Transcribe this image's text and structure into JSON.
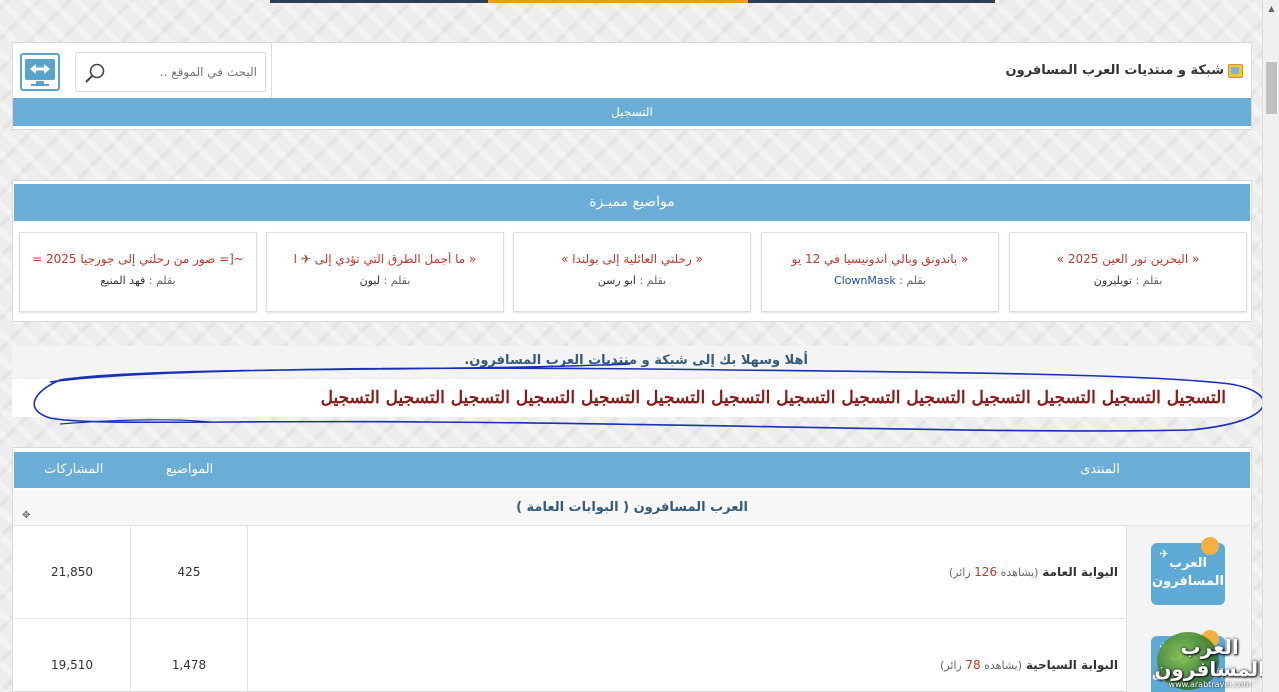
{
  "header": {
    "site_title": "شبكة و منتديات العرب المسافرون",
    "search_placeholder": "البحث في الموقع ..",
    "register_label": "التسجيل"
  },
  "featured": {
    "title": "مواضيع مميـزة",
    "by_label": "بقلم :",
    "cards": [
      {
        "title": "« البحرين نور العين 2025 »",
        "author": "تويليرون",
        "author_color": "#333333"
      },
      {
        "title": "« باندونق وبالي اندونيسيا في 12 يو",
        "author": "ClownMask",
        "author_color": "#1f4fa3"
      },
      {
        "title": "« رحلتي العائلية إلى بولندا »",
        "author": "ابو رسن",
        "author_color": "#333333"
      },
      {
        "title": "« ما أجمل الطرق التي تؤدي إلى ✈ ا",
        "author": "ليون",
        "author_color": "#333333"
      },
      {
        "title": "~[= صور من رحلتي إلى جورجيا 2025 =",
        "author": "فهد المنيع",
        "author_color": "#333333"
      }
    ]
  },
  "welcome": {
    "text": "أهلا وسهلا بك إلى شبكة و منتديات العرب المسافرون.",
    "register_repeat": "التسجيل التسجيل التسجيل التسجيل التسجيل التسجيل التسجيل التسجيل التسجيل التسجيل التسجيل التسجيل التسجيل التسجيل"
  },
  "forum_table": {
    "headers": {
      "forum": "المنتدى",
      "topics": "المواضيع",
      "posts": "المشاركات"
    },
    "section_title": "العرب المسافرون ( البوابات العامة )",
    "logo_text": [
      "العرب",
      "المسافرون"
    ],
    "rows": [
      {
        "name": "البوابة العامة",
        "viewing_prefix": "(يشاهده",
        "viewing_count": "126",
        "viewing_suffix": "زائر)",
        "topics": "425",
        "posts": "21,850"
      },
      {
        "name": "البوابة السياحية",
        "viewing_prefix": "(يشاهده",
        "viewing_count": "78",
        "viewing_suffix": "زائر)",
        "topics": "1,478",
        "posts": "19,510"
      }
    ]
  },
  "watermark": {
    "text_line1": "العرب",
    "text_line2": "المسافرون",
    "url": "www.arabtravel.com"
  },
  "colors": {
    "accent": "#6aaed7",
    "title_red": "#c0392b",
    "register_dark_red": "#8b1a1a",
    "welcome_blue": "#345b7a",
    "scribble": "#1a2fb5"
  }
}
